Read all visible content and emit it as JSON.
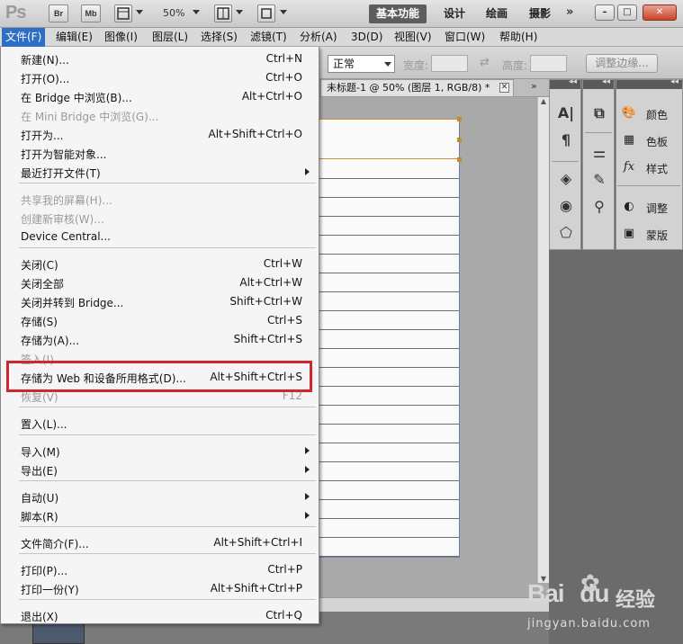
{
  "appbar": {
    "logo": "Ps",
    "bridge_btn": "Br",
    "minibridge_btn": "Mb",
    "zoom": "50%",
    "workspaces": [
      "基本功能",
      "设计",
      "绘画",
      "摄影"
    ],
    "active_workspace": "基本功能",
    "more": "»",
    "window_controls": [
      "–",
      "□",
      "✕"
    ]
  },
  "menubar": {
    "items": [
      "文件(F)",
      "编辑(E)",
      "图像(I)",
      "图层(L)",
      "选择(S)",
      "滤镜(T)",
      "分析(A)",
      "3D(D)",
      "视图(V)",
      "窗口(W)",
      "帮助(H)"
    ],
    "open_item": "文件(F)"
  },
  "options": {
    "mode_value": "正常",
    "width_label": "宽度:",
    "height_label": "高度:",
    "refine_edge_button": "调整边缘..."
  },
  "document": {
    "tab_title": "未标题-1 @ 50% (图层 1, RGB/8) *",
    "close": "✕",
    "expander": "»"
  },
  "file_menu": {
    "items": [
      {
        "label": "新建(N)...",
        "shortcut": "Ctrl+N",
        "disabled": false,
        "submenu": false
      },
      {
        "label": "打开(O)...",
        "shortcut": "Ctrl+O",
        "disabled": false,
        "submenu": false
      },
      {
        "label": "在 Bridge 中浏览(B)...",
        "shortcut": "Alt+Ctrl+O",
        "disabled": false,
        "submenu": false
      },
      {
        "label": "在 Mini Bridge 中浏览(G)...",
        "shortcut": "",
        "disabled": true,
        "submenu": false
      },
      {
        "label": "打开为...",
        "shortcut": "Alt+Shift+Ctrl+O",
        "disabled": false,
        "submenu": false
      },
      {
        "label": "打开为智能对象...",
        "shortcut": "",
        "disabled": false,
        "submenu": false
      },
      {
        "label": "最近打开文件(T)",
        "shortcut": "",
        "disabled": false,
        "submenu": true
      },
      {
        "label": "共享我的屏幕(H)...",
        "shortcut": "",
        "disabled": true,
        "submenu": false
      },
      {
        "label": "创建新审核(W)...",
        "shortcut": "",
        "disabled": true,
        "submenu": false
      },
      {
        "label": "Device Central...",
        "shortcut": "",
        "disabled": false,
        "submenu": false
      },
      {
        "label": "关闭(C)",
        "shortcut": "Ctrl+W",
        "disabled": false,
        "submenu": false
      },
      {
        "label": "关闭全部",
        "shortcut": "Alt+Ctrl+W",
        "disabled": false,
        "submenu": false
      },
      {
        "label": "关闭并转到 Bridge...",
        "shortcut": "Shift+Ctrl+W",
        "disabled": false,
        "submenu": false
      },
      {
        "label": "存储(S)",
        "shortcut": "Ctrl+S",
        "disabled": false,
        "submenu": false
      },
      {
        "label": "存储为(A)...",
        "shortcut": "Shift+Ctrl+S",
        "disabled": false,
        "submenu": false
      },
      {
        "label": "签入(I)...",
        "shortcut": "",
        "disabled": true,
        "submenu": false
      },
      {
        "label": "存储为 Web 和设备所用格式(D)...",
        "shortcut": "Alt+Shift+Ctrl+S",
        "disabled": false,
        "submenu": false,
        "highlighted": true
      },
      {
        "label": "恢复(V)",
        "shortcut": "F12",
        "disabled": true,
        "submenu": false
      },
      {
        "label": "置入(L)...",
        "shortcut": "",
        "disabled": false,
        "submenu": false
      },
      {
        "label": "导入(M)",
        "shortcut": "",
        "disabled": false,
        "submenu": true
      },
      {
        "label": "导出(E)",
        "shortcut": "",
        "disabled": false,
        "submenu": true
      },
      {
        "label": "自动(U)",
        "shortcut": "",
        "disabled": false,
        "submenu": true
      },
      {
        "label": "脚本(R)",
        "shortcut": "",
        "disabled": false,
        "submenu": true
      },
      {
        "label": "文件简介(F)...",
        "shortcut": "Alt+Shift+Ctrl+I",
        "disabled": false,
        "submenu": false
      },
      {
        "label": "打印(P)...",
        "shortcut": "Ctrl+P",
        "disabled": false,
        "submenu": false
      },
      {
        "label": "打印一份(Y)",
        "shortcut": "Alt+Shift+Ctrl+P",
        "disabled": false,
        "submenu": false
      },
      {
        "label": "退出(X)",
        "shortcut": "Ctrl+Q",
        "disabled": false,
        "submenu": false
      }
    ]
  },
  "panels": {
    "dock_collapse": "◂◂",
    "buttons": [
      {
        "label": "颜色",
        "icon": "palette-icon"
      },
      {
        "label": "色板",
        "icon": "swatches-icon"
      },
      {
        "label": "样式",
        "icon": "fx-styles-icon"
      },
      {
        "label": "调整",
        "icon": "adjustments-icon"
      },
      {
        "label": "蒙版",
        "icon": "masks-icon"
      }
    ]
  },
  "watermark": {
    "brand": "Bai",
    "brand_suffix": "du",
    "service": "经验",
    "url": "jingyan.baidu.com"
  },
  "colors": {
    "menu_highlight": "#2f6ec6",
    "callout_border": "#d0262c",
    "selection_border": "#c9953a"
  }
}
